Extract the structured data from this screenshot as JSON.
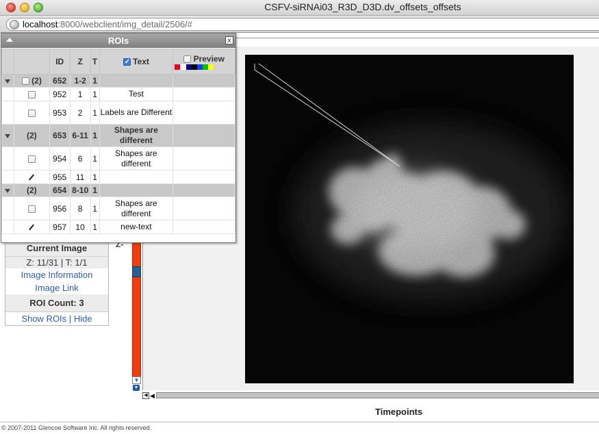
{
  "window": {
    "title": "CSFV-siRNAi03_R3D_D3D.dv_offsets_offsets"
  },
  "address_bar": {
    "host": "localhost",
    "path": ":8000/webclient/img_detail/2506/#"
  },
  "roi_panel": {
    "title": "ROIs",
    "close_glyph": "x",
    "columns": {
      "id": "ID",
      "z": "Z",
      "t": "T",
      "text": "Text",
      "preview": "Preview"
    },
    "text_checked": true,
    "preview_colors": [
      "#e8001c",
      "#ffffff",
      "#000080",
      "#000000",
      "#1a3cff",
      "#00c000",
      "#ffff00"
    ],
    "rows": [
      {
        "kind": "group",
        "count": "(2)",
        "has_checkbox": true,
        "id": "652",
        "z": "1-2",
        "t": "1",
        "text": ""
      },
      {
        "kind": "child",
        "shape": "rect",
        "id": "952",
        "z": "1",
        "t": "1",
        "text": "Test"
      },
      {
        "kind": "child",
        "shape": "rect",
        "id": "953",
        "z": "2",
        "t": "1",
        "text": "Labels are Different"
      },
      {
        "kind": "group",
        "count": "(2)",
        "has_checkbox": false,
        "id": "653",
        "z": "6-11",
        "t": "1",
        "text": "Shapes are different"
      },
      {
        "kind": "child",
        "shape": "rect",
        "id": "954",
        "z": "6",
        "t": "1",
        "text": "Shapes are different"
      },
      {
        "kind": "child",
        "shape": "line",
        "id": "955",
        "z": "11",
        "t": "1",
        "text": ""
      },
      {
        "kind": "group",
        "count": "(2)",
        "has_checkbox": false,
        "id": "654",
        "z": "8-10",
        "t": "1",
        "text": ""
      },
      {
        "kind": "child",
        "shape": "rect",
        "id": "956",
        "z": "8",
        "t": "1",
        "text": "Shapes are different"
      },
      {
        "kind": "child",
        "shape": "line",
        "id": "957",
        "z": "10",
        "t": "1",
        "text": "new-text"
      }
    ]
  },
  "image_panel": {
    "current_image_label": "Current Image",
    "zt_readout": "Z: 11/31 | T: 1/1",
    "image_information_link": "Image Information",
    "image_link": "Image Link",
    "roi_count": "ROI Count: 3",
    "show_rois": "Show ROIs",
    "separator": "|",
    "hide": "Hide"
  },
  "z_slider": {
    "label": "Z-",
    "current": 11,
    "total": 31
  },
  "t_slider": {
    "label": "Timepoints"
  },
  "footer": {
    "copyright": "© 2007-2011 Glencoe Software Inc. All rights reserved."
  },
  "colors": {
    "z_slider": "#f23c0c",
    "z_handle": "#255e9a",
    "link": "#2a5fb0",
    "roi_header": "#8f8f8f"
  }
}
